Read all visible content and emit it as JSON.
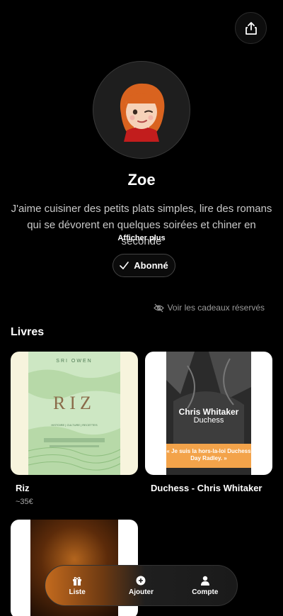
{
  "profile": {
    "name": "Zoe",
    "bio": "J'aime cuisiner des petits plats simples, lire des romans qui se dévorent en quelques soirées et chiner en seconde",
    "show_more": "Afficher plus",
    "follow_label": "Abonné",
    "reserved_link": "Voir les cadeaux réservés"
  },
  "section": {
    "title": "Livres"
  },
  "books": [
    {
      "title": "Riz",
      "price": "~35€",
      "cover": {
        "author": "SRI OWEN",
        "title": "RIZ",
        "subtitle": "HISTOIRE | CULTURE | RECETTES"
      }
    },
    {
      "title": "Duchess - Chris Whitaker",
      "cover": {
        "author": "Chris Whitaker",
        "title": "Duchess",
        "band": "« Je suis la hors-la-loi Duchess Day Radley. »"
      }
    },
    {
      "title": ""
    }
  ],
  "tabbar": {
    "items": [
      {
        "label": "Liste",
        "icon": "gift-icon"
      },
      {
        "label": "Ajouter",
        "icon": "plus-circle-icon"
      },
      {
        "label": "Compte",
        "icon": "user-icon"
      }
    ]
  },
  "colors": {
    "background": "#000000",
    "accent": "#c36a1e"
  }
}
